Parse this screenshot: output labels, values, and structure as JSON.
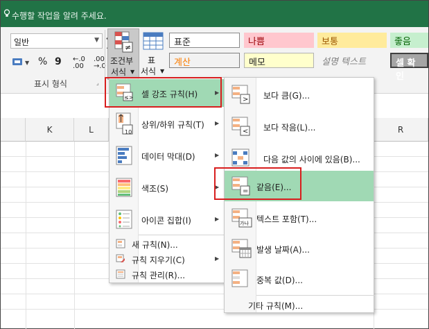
{
  "titlebar": {
    "tell_me": "수행할 작업을 알려 주세요."
  },
  "ribbon": {
    "number_format_value": "일반",
    "percent_label": "%",
    "comma_label": "9",
    "inc_decimal": "←.0\n.00",
    "dec_decimal": ".00\n→.0",
    "number_group_label": "표시 형식",
    "cf_label_line1": "조건부",
    "cf_label_line2": "서식",
    "table_label_line1": "표",
    "table_label_line2": "서식",
    "styles": [
      {
        "label": "표준",
        "bg": "#ffffff",
        "fg": "#000000"
      },
      {
        "label": "나쁨",
        "bg": "#ffc7ce",
        "fg": "#9c0006"
      },
      {
        "label": "보통",
        "bg": "#ffeb9c",
        "fg": "#9c5700"
      },
      {
        "label": "좋음",
        "bg": "#c6efce",
        "fg": "#006100"
      },
      {
        "label": "계산",
        "bg": "#f2f2f2",
        "fg": "#fa7d00"
      },
      {
        "label": "메모",
        "bg": "#ffffcc",
        "fg": "#000000"
      },
      {
        "label": "설명 텍스트",
        "bg": "#f3f3f3",
        "fg": "#7f7f7f"
      },
      {
        "label": "셀 확인",
        "bg": "#a5a5a5",
        "fg": "#ffffff"
      }
    ]
  },
  "sheet": {
    "columns": [
      "K",
      "L",
      "R"
    ]
  },
  "cf_menu": {
    "items": [
      {
        "label": "셀 강조 규칙(H)",
        "has_submenu": true,
        "highlighted": true
      },
      {
        "label": "상위/하위 규칙(T)",
        "has_submenu": true
      },
      {
        "label": "데이터 막대(D)",
        "has_submenu": true
      },
      {
        "label": "색조(S)",
        "has_submenu": true
      },
      {
        "label": "아이콘 집합(I)",
        "has_submenu": true
      }
    ],
    "small_items": [
      {
        "label": "새 규칙(N)..."
      },
      {
        "label": "규칙 지우기(C)",
        "has_submenu": true
      },
      {
        "label": "규칙 관리(R)..."
      }
    ],
    "icon_10": "10"
  },
  "sub_menu": {
    "items": [
      {
        "label": "보다 큼(G)...",
        "icon_sym": ">"
      },
      {
        "label": "보다 작음(L)...",
        "icon_sym": "<"
      },
      {
        "label": "다음 값의 사이에 있음(B)...",
        "icon_sym": ""
      },
      {
        "label": "같음(E)...",
        "icon_sym": "=",
        "highlighted": true
      },
      {
        "label": "텍스트 포함(T)...",
        "icon_sym": "가나"
      },
      {
        "label": "발생 날짜(A)...",
        "icon_sym": ""
      },
      {
        "label": "중복 값(D)...",
        "icon_sym": ""
      }
    ],
    "more_rules": "기타 규칙(M)..."
  },
  "colors": {
    "title": "#217346",
    "highlight": "#a0d9b4",
    "red_box": "#d81e1e"
  }
}
